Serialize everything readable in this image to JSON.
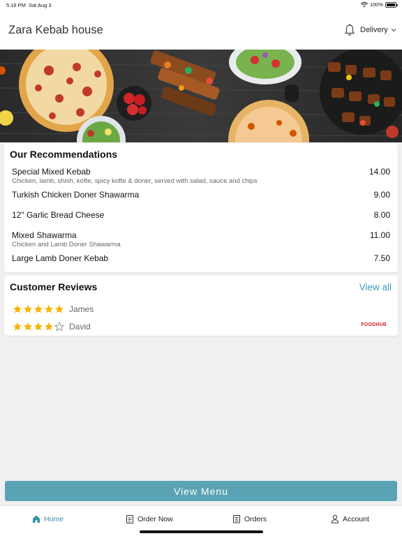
{
  "status_bar": {
    "time": "5:16 PM",
    "date": "Sat Aug 3",
    "battery": "100%",
    "battery_level": 1.0,
    "wifi_icon": "wifi-icon",
    "battery_icon": "battery-icon"
  },
  "header": {
    "title": "Zara Kebab house",
    "notification_icon": "bell-icon",
    "mode_label": "Delivery",
    "mode_icon": "chevron-down-icon"
  },
  "recommendations": {
    "title": "Our Recommendations",
    "items": [
      {
        "name": "Special Mixed Kebab",
        "description": "Chicken, lamb, shish, kofte, spicy kofte & doner, served with salad, sauce and chips",
        "price": "14.00"
      },
      {
        "name": "Turkish Chicken Doner Shawarma",
        "description": "",
        "price": "9.00"
      },
      {
        "name": "12\" Garlic Bread Cheese",
        "description": "",
        "price": "8.00"
      },
      {
        "name": "Mixed Shawarma",
        "description": "Chicken and Lamb Doner Shawarma",
        "price": "11.00"
      },
      {
        "name": "Large Lamb Doner Kebab",
        "description": "",
        "price": "7.50"
      }
    ]
  },
  "reviews": {
    "title": "Customer Reviews",
    "view_all_label": "View all",
    "items": [
      {
        "name": "James",
        "rating": 5,
        "max_rating": 5
      },
      {
        "name": "David",
        "rating": 4,
        "max_rating": 5
      }
    ],
    "brand_logo": "FOODHUB"
  },
  "actions": {
    "view_menu_label": "View Menu"
  },
  "bottom_nav": {
    "items": [
      {
        "label": "Home",
        "icon": "home-icon",
        "active": true
      },
      {
        "label": "Order Now",
        "icon": "clipboard-icon",
        "active": false
      },
      {
        "label": "Orders",
        "icon": "receipt-icon",
        "active": false
      },
      {
        "label": "Account",
        "icon": "user-icon",
        "active": false
      }
    ]
  },
  "colors": {
    "accent": "#3a9cb4",
    "button": "#5aa3b4",
    "star": "#f5b400",
    "brand_red": "#d0202a"
  }
}
